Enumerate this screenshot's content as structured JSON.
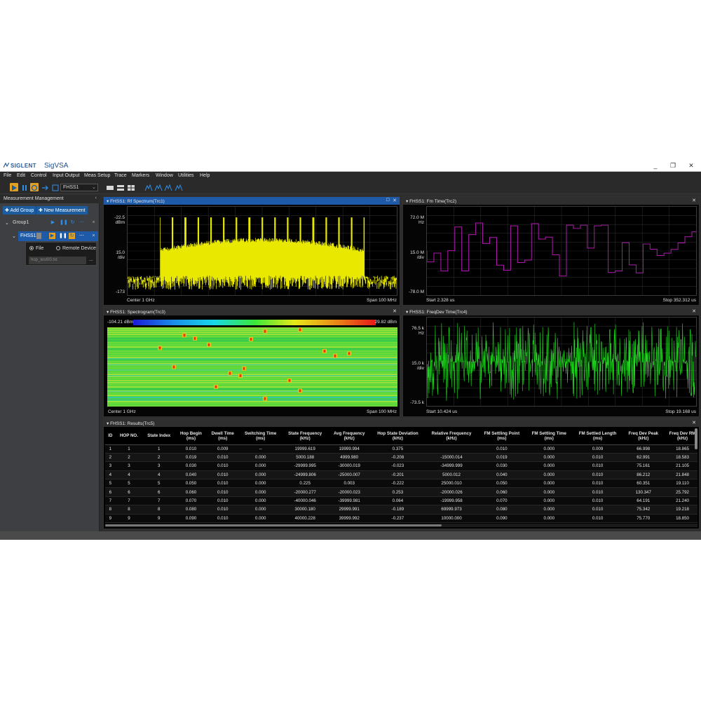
{
  "brand": "SIGLENT",
  "app_title": "SigVSA",
  "window_controls": [
    "_",
    "❐",
    "✕"
  ],
  "menu": [
    "File",
    "Edit",
    "Control",
    "Input Output",
    "Meas Setup",
    "Trace",
    "Markers",
    "Window",
    "Utilities",
    "Help"
  ],
  "toolbar": {
    "measurement_select": "FHSS1"
  },
  "sidebar": {
    "title": "Measurement Management",
    "add_group": "Add Group",
    "new_measurement": "New Measurement",
    "group_label": "Group1",
    "meas_label": "FHSS1",
    "source_file": "File",
    "source_remote": "Remote Device",
    "file_name": "hop_test00.txt",
    "browse": "..."
  },
  "trc1": {
    "title": "FHSS1: Rf Spectrum(Trc1)",
    "y_top": "-22.5",
    "y_top_unit": "dBm",
    "y_mid": "15.0",
    "y_mid_unit": "/div",
    "y_bot": "-173",
    "footer_left": "Center  1 GHz",
    "footer_right": "Span  100 MHz"
  },
  "trc2": {
    "title": "FHSS1: Fm Time(Trc2)",
    "y_top": "72.0 M",
    "y_top_unit": "Hz",
    "y_mid": "15.0 M",
    "y_mid_unit": "/div",
    "y_bot": "-78.0 M",
    "footer_left": "Start  2.328 us",
    "footer_right": "Stop  352.312 us"
  },
  "trc3": {
    "title": "FHSS1: Spectrogram(Trc3)",
    "scale_min": "-104.21 dBm",
    "scale_max": "29.82 dBm",
    "footer_left": "Center  1 GHz",
    "footer_right": "Span  100 MHz"
  },
  "trc4": {
    "title": "FHSS1: FreqDev Time(Trc4)",
    "y_top": "76.5 k",
    "y_top_unit": "Hz",
    "y_mid": "15.0 k",
    "y_mid_unit": "/div",
    "y_bot": "-73.5 k",
    "footer_left": "Start  10.424 us",
    "footer_right": "Stop  19.168 us"
  },
  "trc5": {
    "title": "FHSS1: Results(Trc5)"
  },
  "results": {
    "columns": [
      "ID",
      "HOP NO.",
      "State Index",
      "Hop Begin\n(ms)",
      "Dwell Time\n(ms)",
      "Switching Time\n(ms)",
      "State Frequency\n(kHz)",
      "Avg Frequency\n(kHz)",
      "Hop State Deviation\n(kHz)",
      "Relative Frequency\n(kHz)",
      "FM Settling Point\n(ms)",
      "FM Settling Time\n(ms)",
      "FM Settled Length\n(ms)",
      "Freq Dev Peak\n(kHz)",
      "Freq Dev RM\n(kHz)"
    ],
    "rows": [
      [
        "1",
        "1",
        "1",
        "0.010",
        "0.009",
        "--",
        "19999.619",
        "19999.994",
        "0.375",
        "",
        "0.010",
        "0.000",
        "0.009",
        "66.998",
        "18.865"
      ],
      [
        "2",
        "2",
        "2",
        "0.019",
        "0.010",
        "0.000",
        "5000.188",
        "4999.980",
        "-0.208",
        "-15000.014",
        "0.019",
        "0.000",
        "0.010",
        "62.991",
        "18.583"
      ],
      [
        "3",
        "3",
        "3",
        "0.030",
        "0.010",
        "0.000",
        "-29999.995",
        "-30000.019",
        "-0.023",
        "-34999.999",
        "0.030",
        "0.000",
        "0.010",
        "75.161",
        "21.105"
      ],
      [
        "4",
        "4",
        "4",
        "0.040",
        "0.010",
        "0.000",
        "-24999.806",
        "-25000.007",
        "-0.201",
        "5000.012",
        "0.040",
        "0.000",
        "0.010",
        "86.212",
        "21.848"
      ],
      [
        "5",
        "5",
        "5",
        "0.050",
        "0.010",
        "0.000",
        "0.225",
        "0.003",
        "-0.222",
        "25000.010",
        "0.050",
        "0.000",
        "0.010",
        "60.351",
        "19.110"
      ],
      [
        "6",
        "6",
        "6",
        "0.060",
        "0.010",
        "0.000",
        "-20000.277",
        "-20000.023",
        "0.253",
        "-20000.026",
        "0.060",
        "0.000",
        "0.010",
        "130.347",
        "25.792"
      ],
      [
        "7",
        "7",
        "7",
        "0.070",
        "0.010",
        "0.000",
        "-40000.046",
        "-39999.981",
        "0.064",
        "-19999.958",
        "0.070",
        "0.000",
        "0.010",
        "64.191",
        "21.240"
      ],
      [
        "8",
        "8",
        "8",
        "0.080",
        "0.010",
        "0.000",
        "30000.180",
        "29999.991",
        "-0.189",
        "69999.973",
        "0.080",
        "0.000",
        "0.010",
        "75.342",
        "19.218"
      ],
      [
        "9",
        "9",
        "9",
        "0.090",
        "0.010",
        "0.000",
        "40000.228",
        "39999.992",
        "-0.237",
        "10000.000",
        "0.090",
        "0.000",
        "0.010",
        "75.770",
        "18.850"
      ]
    ]
  },
  "colors": {
    "spectrum": "#e8e800",
    "fm_trace": "#b01ab0",
    "freqdev_trace": "#22dd22",
    "accent": "#1e5aa8"
  }
}
